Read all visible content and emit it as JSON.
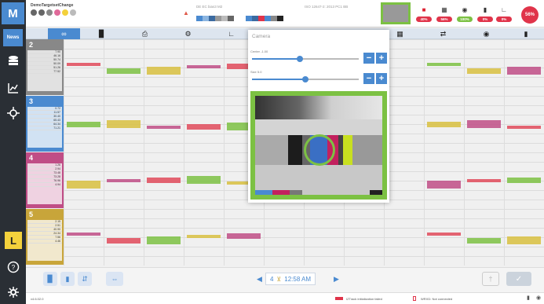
{
  "header": {
    "job_name": "DemoTargetsetChange",
    "file_label": "DE EC bias3 M2",
    "iso_label": "ISO 12647-2: 2013 PC1 BB",
    "badges": [
      "40%",
      "56%",
      "100%",
      "0%",
      "0%"
    ],
    "score": "56%"
  },
  "sidebar": {
    "news_label": "News",
    "layout_label": "L",
    "logo": "M"
  },
  "camera": {
    "title": "Camera",
    "center_label": "Center -1.00",
    "center_value": 0.45,
    "size_label": "Size 5.0",
    "size_value": 0.5,
    "minus": "−",
    "plus": "+"
  },
  "rows": [
    {
      "number": "2",
      "color": "#888888",
      "values": [
        "7.90",
        "46.16",
        "50.74",
        "50.09",
        "51.26",
        "77.52"
      ]
    },
    {
      "number": "3",
      "color": "#4a8ad0",
      "values": [
        "0.72",
        "11.57",
        "30.40",
        "65.43",
        "64.34",
        "71.21"
      ]
    },
    {
      "number": "4",
      "color": "#c04d86",
      "values": [
        "1.26",
        "2.94",
        "73.48",
        "73.28",
        "76.96",
        "4.94"
      ]
    },
    {
      "number": "5",
      "color": "#c8a53a",
      "values": [
        "2.15",
        "2.51",
        "40.90",
        "24.34",
        "7.56",
        "4.46"
      ]
    }
  ],
  "footer": {
    "page": "4",
    "time": "12:58 AM"
  },
  "status": {
    "version": "v4.6.02.0",
    "track_msg": "IZTrack initialization failed",
    "wrx_msg": "WRXD: Not connected"
  }
}
